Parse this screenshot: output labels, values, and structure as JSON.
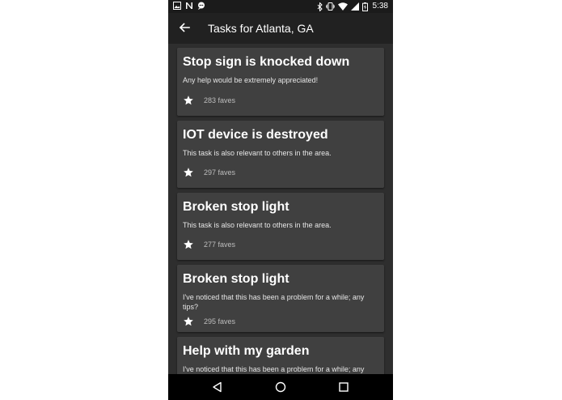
{
  "status_bar": {
    "time": "5:38",
    "left_icons": [
      "image-icon",
      "n-app-icon",
      "chat-icon"
    ],
    "right_icons": [
      "bluetooth-icon",
      "vibrate-icon",
      "wifi-icon",
      "signal-icon",
      "battery-icon"
    ]
  },
  "app_bar": {
    "back_icon": "arrow-left-icon",
    "title": "Tasks for Atlanta, GA"
  },
  "tasks": [
    {
      "title": "Stop sign is knocked down",
      "description": "Any help would be extremely appreciated!",
      "faves": "283 faves"
    },
    {
      "title": "IOT device is destroyed",
      "description": "This task is also relevant to others in the area.",
      "faves": "297 faves"
    },
    {
      "title": "Broken stop light",
      "description": "This task is also relevant to others in the area.",
      "faves": "277 faves"
    },
    {
      "title": "Broken stop light",
      "description": "I've noticed that this has been a problem for a while; any tips?",
      "faves": "295 faves"
    },
    {
      "title": "Help with my garden",
      "description": "I've noticed that this has been a problem for a while; any tips?",
      "faves": ""
    }
  ],
  "nav_bar": {
    "icons": [
      "back-triangle-icon",
      "home-circle-icon",
      "recents-square-icon"
    ]
  },
  "colors": {
    "background": "#2e2e2e",
    "app_bar": "#212121",
    "status_bar": "#1b1b1b",
    "card": "#404040",
    "nav_bar": "#000000",
    "title_text": "#ffffff",
    "secondary_text": "#bdbdbd"
  }
}
